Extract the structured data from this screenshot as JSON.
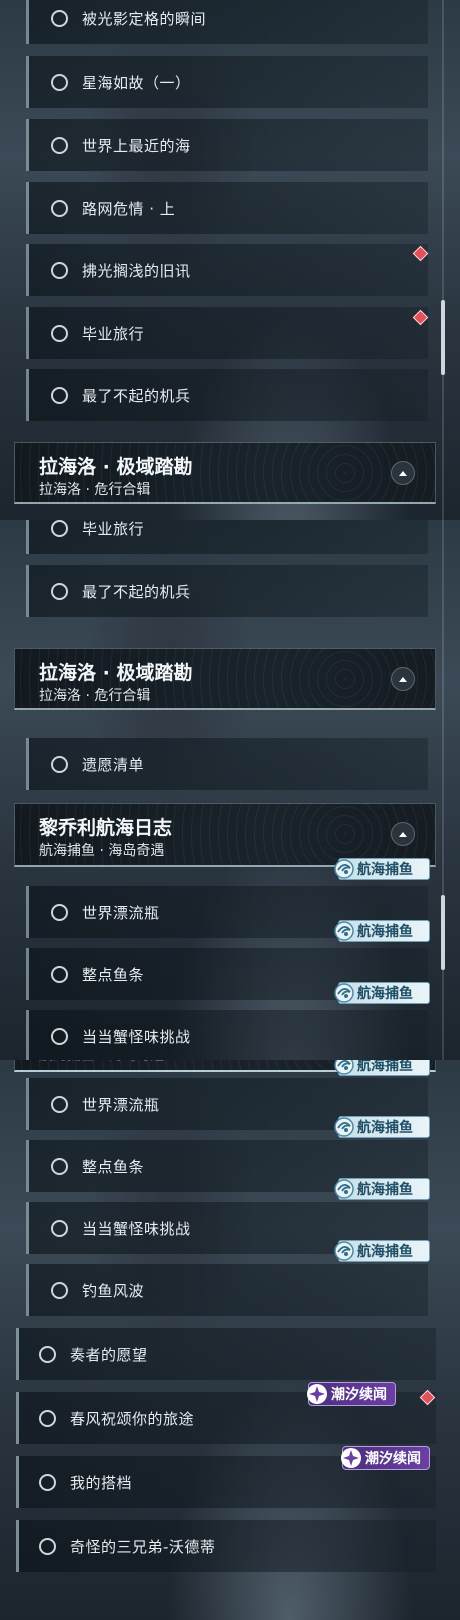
{
  "labels": {
    "bgwj": "被光影定格的瞬间",
    "xhrg": "星海如故（一）",
    "sjzj": "世界上最近的海",
    "lwwq": "路网危情 · 上",
    "fgjq": "拂光搁浅的旧讯",
    "byxl": "毕业旅行",
    "zlbq": "最了不起的机兵",
    "yyqd": "遗愿清单",
    "sjpl": "世界漂流瓶",
    "zdyt": "整点鱼条",
    "ddxg": "当当蟹怪味挑战",
    "dyfb": "钓鱼风波",
    "zzdy": "奏者的愿望",
    "cfzs": "春风祝颂你的旅途",
    "wddd": "我的搭档",
    "qgsx": "奇怪的三兄弟-沃德蒂"
  },
  "groups": {
    "lahailuo": {
      "title": "拉海洛 · 极域踏勘",
      "subtitle": "拉海洛 · 危行合辑"
    },
    "liqiao": {
      "title": "黎乔利航海日志",
      "subtitle": "航海捕鱼 · 海岛奇遇"
    }
  },
  "tags": {
    "fishing": "航海捕鱼",
    "tide": "潮汐续闻"
  },
  "colors": {
    "fishing_tag_bg": "#d8ebf2",
    "tide_tag_bg": "#5a3690",
    "alert_diamond": "#e0515a",
    "row_accent": "#bcd2dc"
  }
}
